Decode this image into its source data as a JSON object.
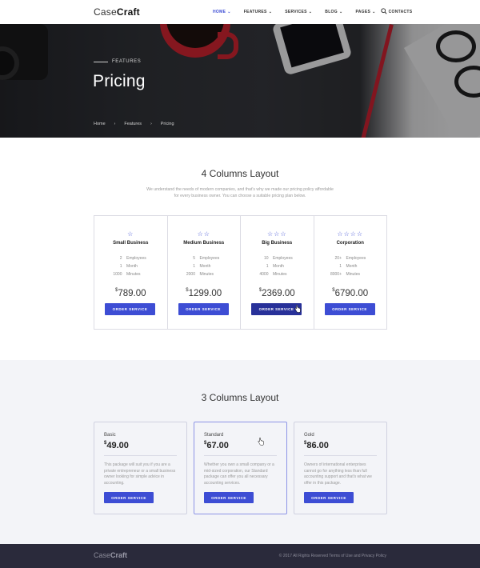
{
  "nav": {
    "logo_thin": "Case",
    "logo_bold": "Craft",
    "items": [
      {
        "label": "HOME",
        "dropdown": true,
        "active": true
      },
      {
        "label": "FEATURES",
        "dropdown": true
      },
      {
        "label": "SERVICES",
        "dropdown": true
      },
      {
        "label": "BLOG",
        "dropdown": true
      },
      {
        "label": "PAGES",
        "dropdown": true
      },
      {
        "label": "CONTACTS",
        "dropdown": false
      }
    ],
    "search_icon": "search-icon"
  },
  "hero": {
    "eyebrow": "FEATURES",
    "title": "Pricing",
    "breadcrumb": [
      "Home",
      "Features",
      "Pricing"
    ]
  },
  "four_columns": {
    "title": "4 Columns Layout",
    "subtitle": "We understand the needs of modern companies, and that's why we made our pricing policy affordable for every business owner. You can choose a suitable pricing plan below.",
    "plans": [
      {
        "stars": "☆",
        "name": "Small Business",
        "features": [
          [
            "2",
            "Employees"
          ],
          [
            "1",
            "Month"
          ],
          [
            "1000",
            "Minutes"
          ]
        ],
        "currency": "$",
        "price": "789.00",
        "button": "ORDER SERVICE"
      },
      {
        "stars": "☆☆",
        "name": "Medium Business",
        "features": [
          [
            "5",
            "Employees"
          ],
          [
            "1",
            "Month"
          ],
          [
            "2000",
            "Minutes"
          ]
        ],
        "currency": "$",
        "price": "1299.00",
        "button": "ORDER SERVICE"
      },
      {
        "stars": "☆☆☆",
        "name": "Big Business",
        "features": [
          [
            "10",
            "Employees"
          ],
          [
            "1",
            "Month"
          ],
          [
            "4000",
            "Minutes"
          ]
        ],
        "currency": "$",
        "price": "2369.00",
        "button": "ORDER SERVICE"
      },
      {
        "stars": "☆☆☆☆",
        "name": "Corporation",
        "features": [
          [
            "20+",
            "Employees"
          ],
          [
            "1",
            "Month"
          ],
          [
            "8000+",
            "Minutes"
          ]
        ],
        "currency": "$",
        "price": "6790.00",
        "button": "ORDER SERVICE"
      }
    ]
  },
  "three_columns": {
    "title": "3 Columns Layout",
    "plans": [
      {
        "name": "Basic",
        "currency": "$",
        "price": "49.00",
        "description": "This package will suit you if you are a private entrepreneur or a small business owner looking for simple advice in accounting.",
        "button": "ORDER SERVICE"
      },
      {
        "name": "Standard",
        "currency": "$",
        "price": "67.00",
        "description": "Whether you own a small company or a mid-sized corporation, our Standard package can offer you all necessary accounting services.",
        "button": "ORDER SERVICE"
      },
      {
        "name": "Gold",
        "currency": "$",
        "price": "86.00",
        "description": "Owners of international enterprises cannot go for anything less than full accounting support and that's what we offer in this package.",
        "button": "ORDER SERVICE"
      }
    ]
  },
  "footer": {
    "logo_thin": "Case",
    "logo_bold": "Craft",
    "copyright": "© 2017 All Rights Reserved  Terms of Use and Privacy Policy"
  },
  "colors": {
    "accent": "#3d4dd4",
    "accent_hover": "#283199",
    "footer_bg": "#2a2a3b",
    "section_alt_bg": "#f3f4f8"
  }
}
